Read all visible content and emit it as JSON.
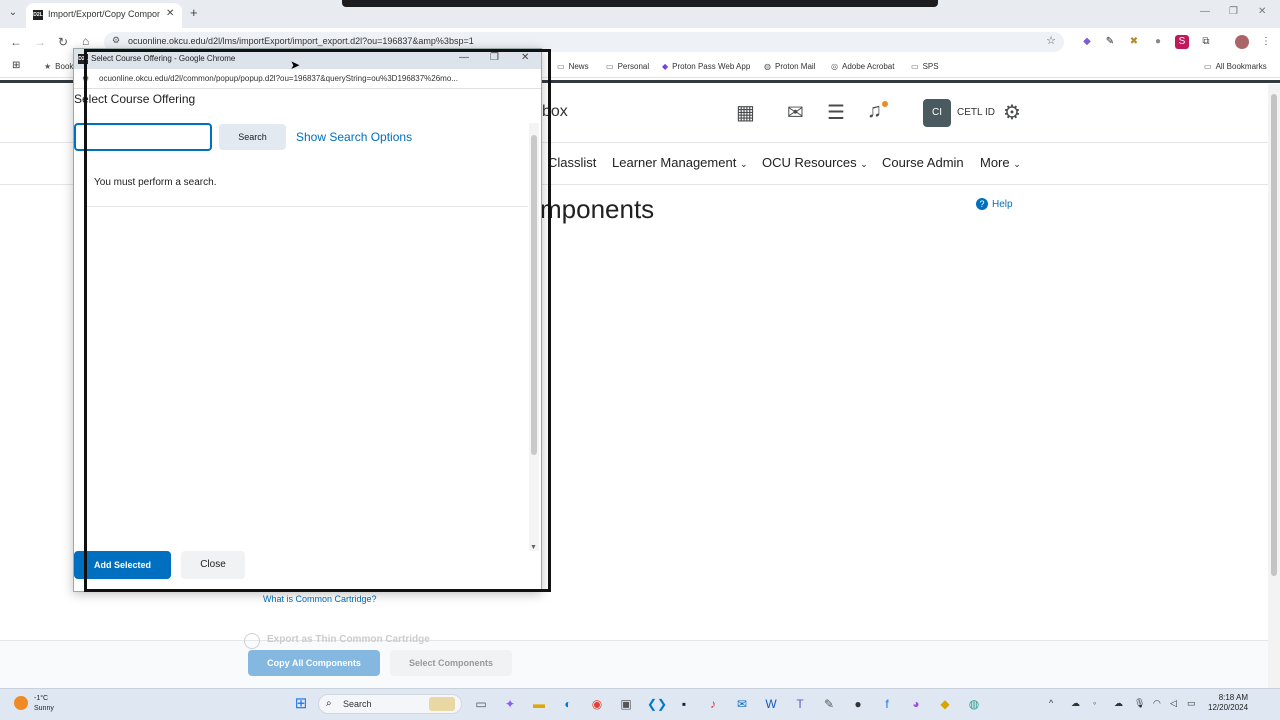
{
  "browser": {
    "tab_title": "Import/Export/Copy Componen",
    "favicon_text": "D2L",
    "url": "ocuonline.okcu.edu/d2l/lms/importExport/import_export.d2l?ou=196837&amp%3bsp=1",
    "bookmarks": [
      {
        "label": "Book",
        "icon": "star-icon"
      },
      {
        "label": "News",
        "icon": "folder-icon"
      },
      {
        "label": "Personal",
        "icon": "folder-icon"
      },
      {
        "label": "Proton Pass Web App",
        "icon": "proton-pass-icon"
      },
      {
        "label": "Proton Mail",
        "icon": "globe-icon"
      },
      {
        "label": "Adobe Acrobat",
        "icon": "acrobat-icon"
      },
      {
        "label": "SPS",
        "icon": "folder-icon"
      }
    ],
    "all_bookmarks": "All Bookmarks"
  },
  "d2l": {
    "org_title_fragment": "box",
    "user_badge": "CI",
    "user_name": "CETL ID",
    "nav": [
      "Classlist",
      "Learner Management",
      "OCU Resources",
      "Course Admin",
      "More"
    ],
    "page_title_fragment": "mponents",
    "help": "Help",
    "cc_link": "What is Common Cartridge?",
    "export_option": "Export as Thin Common Cartridge",
    "copy_all_btn": "Copy All Components",
    "select_components_btn": "Select Components"
  },
  "popup": {
    "window_title": "Select Course Offering - Google Chrome",
    "url": "ocuonline.okcu.edu/d2l/common/popup/popup.d2l?ou=196837&queryString=ou%3D196837%26mo...",
    "heading": "Select Course Offering",
    "search_value": "",
    "search_button": "Search",
    "show_search_options": "Show Search Options",
    "results_message": "You must perform a search.",
    "add_selected": "Add Selected",
    "close": "Close"
  },
  "taskbar": {
    "temp": "-1°C",
    "weather": "Sunny",
    "search_label": "Search",
    "time": "8:18 AM",
    "date": "12/20/2024"
  },
  "colors": {
    "d2l_blue": "#006fbf",
    "disabled_blue": "#85b8e1"
  }
}
